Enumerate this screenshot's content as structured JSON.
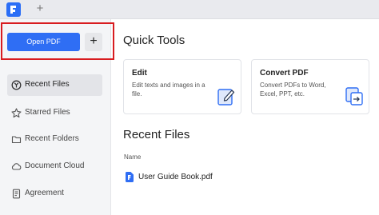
{
  "tabbar": {
    "new_tab_symbol": "+"
  },
  "sidebar": {
    "open_pdf_label": "Open PDF",
    "add_symbol": "+",
    "items": [
      {
        "label": "Recent Files",
        "icon": "recent-files-icon",
        "active": true
      },
      {
        "label": "Starred Files",
        "icon": "star-icon",
        "active": false
      },
      {
        "label": "Recent Folders",
        "icon": "folder-icon",
        "active": false
      },
      {
        "label": "Document Cloud",
        "icon": "cloud-icon",
        "active": false
      },
      {
        "label": "Agreement",
        "icon": "agreement-icon",
        "active": false
      }
    ]
  },
  "main": {
    "quick_tools_title": "Quick Tools",
    "tools": [
      {
        "title": "Edit",
        "description": "Edit texts and images in a file.",
        "icon": "edit-icon"
      },
      {
        "title": "Convert PDF",
        "description": "Convert PDFs to Word, Excel, PPT, etc.",
        "icon": "convert-icon"
      }
    ],
    "recent_files_title": "Recent Files",
    "column_name": "Name",
    "files": [
      {
        "name": "User Guide Book.pdf",
        "icon": "pdf-file-icon"
      }
    ]
  },
  "colors": {
    "accent": "#2f6ef4",
    "highlight": "#d81c20",
    "sidebar_bg": "#f4f5f7"
  }
}
